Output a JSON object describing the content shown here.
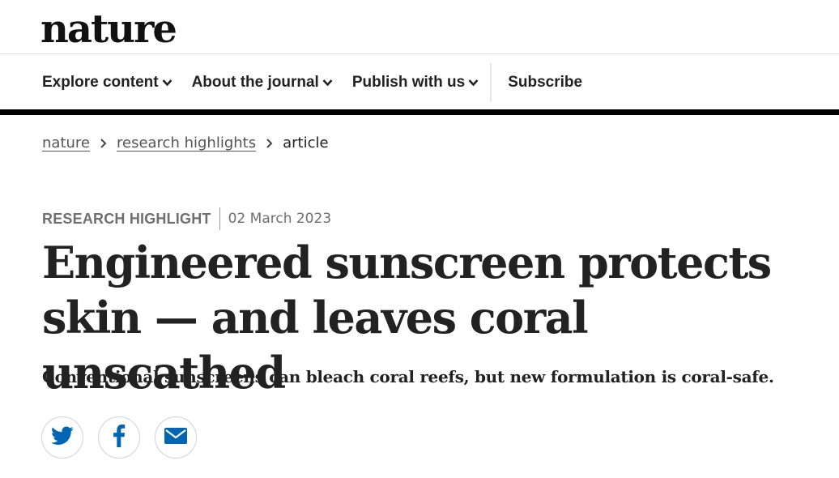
{
  "brand": {
    "logo_text": "nature"
  },
  "nav": {
    "items": [
      {
        "label": "Explore content",
        "has_dropdown": true
      },
      {
        "label": "About the journal",
        "has_dropdown": true
      },
      {
        "label": "Publish with us",
        "has_dropdown": true
      }
    ],
    "subscribe_label": "Subscribe"
  },
  "breadcrumb": {
    "items": [
      "nature",
      "research highlights"
    ],
    "current": "article"
  },
  "article": {
    "type": "RESEARCH HIGHLIGHT",
    "date": "02 March 2023",
    "title": "Engineered sunscreen protects skin — and leaves coral unscathed",
    "standfirst": "Conventional sunscreens can bleach coral reefs, but new formulation is coral-safe."
  },
  "share": {
    "icons": [
      "twitter-icon",
      "facebook-icon",
      "email-icon"
    ],
    "accent_color": "#0066b3"
  },
  "colors": {
    "text": "#222222",
    "muted": "#6f6f6f",
    "bar": "#000000",
    "share_icon": "#0066b3"
  }
}
